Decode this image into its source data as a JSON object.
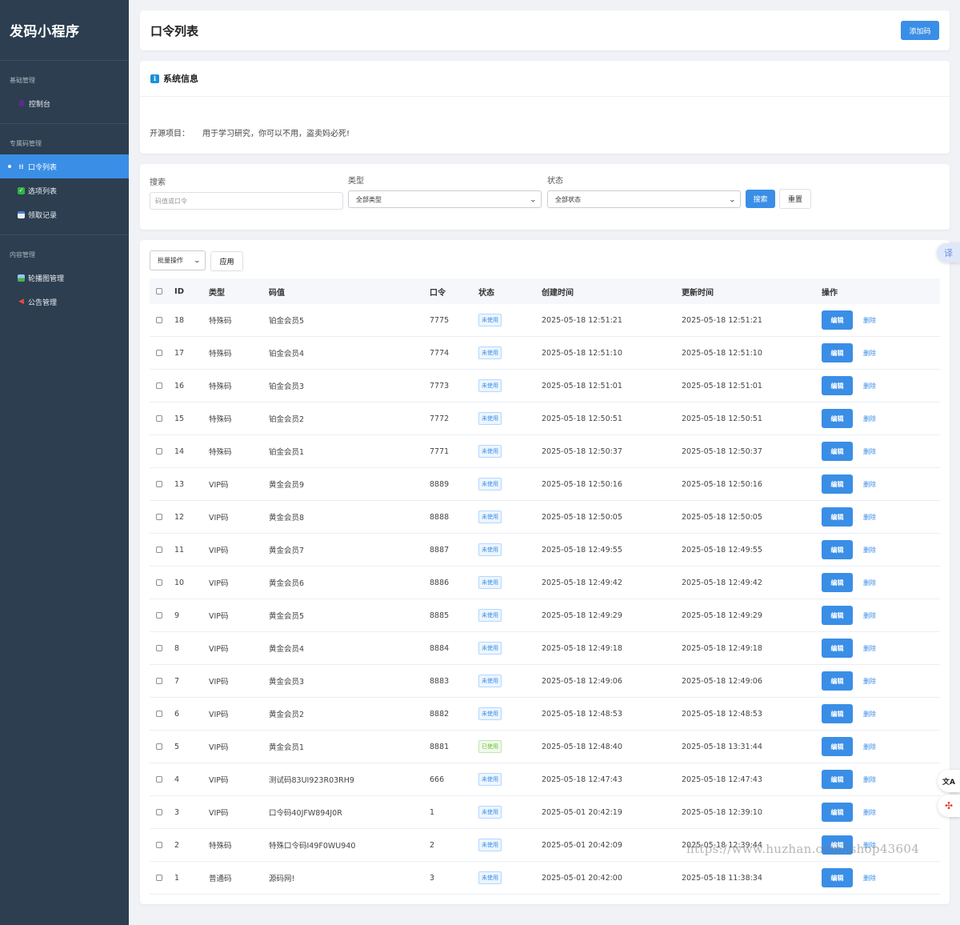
{
  "sidebar": {
    "brand": "发码小程序",
    "groups": [
      {
        "title": "基础管理",
        "items": [
          {
            "label": "控制台",
            "icon": "dashboard-icon",
            "active": false
          }
        ]
      },
      {
        "title": "专属码管理",
        "items": [
          {
            "label": "口令列表",
            "icon": "list-icon",
            "active": true
          },
          {
            "label": "选项列表",
            "icon": "check-icon",
            "active": false
          },
          {
            "label": "领取记录",
            "icon": "calendar-icon",
            "active": false
          }
        ]
      },
      {
        "title": "内容管理",
        "items": [
          {
            "label": "轮播图管理",
            "icon": "image-icon",
            "active": false
          },
          {
            "label": "公告管理",
            "icon": "megaphone-icon",
            "active": false
          }
        ]
      }
    ]
  },
  "header": {
    "title": "口令列表",
    "add_label": "添加码"
  },
  "info": {
    "title": "系统信息",
    "label": "开源项目：",
    "text": "用于学习研究，你可以不用，盗卖妈必死!"
  },
  "filters": {
    "search_label": "搜索",
    "search_placeholder": "码值或口令",
    "type_label": "类型",
    "type_value": "全部类型",
    "status_label": "状态",
    "status_value": "全部状态",
    "search_button": "搜索",
    "reset_button": "重置"
  },
  "table": {
    "batch_label": "批量操作",
    "apply_label": "应用",
    "columns": [
      "ID",
      "类型",
      "码值",
      "口令",
      "状态",
      "创建时间",
      "更新时间",
      "操作"
    ],
    "edit_label": "编辑",
    "delete_label": "删除",
    "rows": [
      {
        "id": "18",
        "type": "特殊码",
        "code": "铂金会员5",
        "cmd": "7775",
        "status": "未使用",
        "used": false,
        "created": "2025-05-18 12:51:21",
        "updated": "2025-05-18 12:51:21"
      },
      {
        "id": "17",
        "type": "特殊码",
        "code": "铂金会员4",
        "cmd": "7774",
        "status": "未使用",
        "used": false,
        "created": "2025-05-18 12:51:10",
        "updated": "2025-05-18 12:51:10"
      },
      {
        "id": "16",
        "type": "特殊码",
        "code": "铂金会员3",
        "cmd": "7773",
        "status": "未使用",
        "used": false,
        "created": "2025-05-18 12:51:01",
        "updated": "2025-05-18 12:51:01"
      },
      {
        "id": "15",
        "type": "特殊码",
        "code": "铂金会员2",
        "cmd": "7772",
        "status": "未使用",
        "used": false,
        "created": "2025-05-18 12:50:51",
        "updated": "2025-05-18 12:50:51"
      },
      {
        "id": "14",
        "type": "特殊码",
        "code": "铂金会员1",
        "cmd": "7771",
        "status": "未使用",
        "used": false,
        "created": "2025-05-18 12:50:37",
        "updated": "2025-05-18 12:50:37"
      },
      {
        "id": "13",
        "type": "VIP码",
        "code": "黄金会员9",
        "cmd": "8889",
        "status": "未使用",
        "used": false,
        "created": "2025-05-18 12:50:16",
        "updated": "2025-05-18 12:50:16"
      },
      {
        "id": "12",
        "type": "VIP码",
        "code": "黄金会员8",
        "cmd": "8888",
        "status": "未使用",
        "used": false,
        "created": "2025-05-18 12:50:05",
        "updated": "2025-05-18 12:50:05"
      },
      {
        "id": "11",
        "type": "VIP码",
        "code": "黄金会员7",
        "cmd": "8887",
        "status": "未使用",
        "used": false,
        "created": "2025-05-18 12:49:55",
        "updated": "2025-05-18 12:49:55"
      },
      {
        "id": "10",
        "type": "VIP码",
        "code": "黄金会员6",
        "cmd": "8886",
        "status": "未使用",
        "used": false,
        "created": "2025-05-18 12:49:42",
        "updated": "2025-05-18 12:49:42"
      },
      {
        "id": "9",
        "type": "VIP码",
        "code": "黄金会员5",
        "cmd": "8885",
        "status": "未使用",
        "used": false,
        "created": "2025-05-18 12:49:29",
        "updated": "2025-05-18 12:49:29"
      },
      {
        "id": "8",
        "type": "VIP码",
        "code": "黄金会员4",
        "cmd": "8884",
        "status": "未使用",
        "used": false,
        "created": "2025-05-18 12:49:18",
        "updated": "2025-05-18 12:49:18"
      },
      {
        "id": "7",
        "type": "VIP码",
        "code": "黄金会员3",
        "cmd": "8883",
        "status": "未使用",
        "used": false,
        "created": "2025-05-18 12:49:06",
        "updated": "2025-05-18 12:49:06"
      },
      {
        "id": "6",
        "type": "VIP码",
        "code": "黄金会员2",
        "cmd": "8882",
        "status": "未使用",
        "used": false,
        "created": "2025-05-18 12:48:53",
        "updated": "2025-05-18 12:48:53"
      },
      {
        "id": "5",
        "type": "VIP码",
        "code": "黄金会员1",
        "cmd": "8881",
        "status": "已使用",
        "used": true,
        "created": "2025-05-18 12:48:40",
        "updated": "2025-05-18 13:31:44"
      },
      {
        "id": "4",
        "type": "VIP码",
        "code": "测试码83UI923R03RH9",
        "cmd": "666",
        "status": "未使用",
        "used": false,
        "created": "2025-05-18 12:47:43",
        "updated": "2025-05-18 12:47:43"
      },
      {
        "id": "3",
        "type": "VIP码",
        "code": "口令码40JFW894J0R",
        "cmd": "1",
        "status": "未使用",
        "used": false,
        "created": "2025-05-01 20:42:19",
        "updated": "2025-05-18 12:39:10"
      },
      {
        "id": "2",
        "type": "特殊码",
        "code": "特殊口令码I49F0WU940",
        "cmd": "2",
        "status": "未使用",
        "used": false,
        "created": "2025-05-01 20:42:09",
        "updated": "2025-05-18 12:39:44"
      },
      {
        "id": "1",
        "type": "普通码",
        "code": "源码网!",
        "cmd": "3",
        "status": "未使用",
        "used": false,
        "created": "2025-05-01 20:42:00",
        "updated": "2025-05-18 11:38:34"
      }
    ]
  },
  "widgets": {
    "translate_label": "译",
    "ai_label": "文A"
  },
  "watermark": "https://www.huzhan.com/ishop43604",
  "colors": {
    "sidebar": "#2c3e50",
    "accent": "#3a8ee6",
    "used": "#67c23a"
  }
}
